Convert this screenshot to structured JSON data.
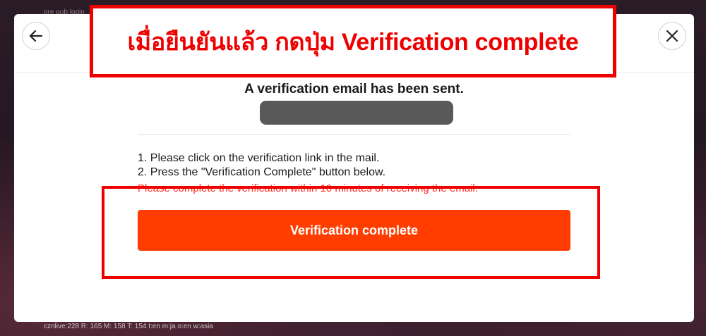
{
  "background": {
    "debug_top": "pre pub login",
    "debug_bottom": "cznlive:228 R: 165 M: 158 T: 154 t:en m:ja o:en w:asia"
  },
  "modal": {
    "title": "A verification email has been sent.",
    "instructions": [
      "1. Please click on the verification link in the mail.",
      "2. Press the \"Verification Complete\" button below."
    ],
    "warning": "Please complete the verification within 10 minutes of receiving the email.",
    "verify_button_label": "Verification complete",
    "back_icon": "arrow-left-icon",
    "close_icon": "close-icon"
  },
  "annotation": {
    "caption": "เมื่อยืนยันแล้ว กดปุ่ม Verification complete"
  },
  "colors": {
    "accent_button": "#ff3d00",
    "warning_text": "#ff2a1f",
    "annotation_red": "#ee0000",
    "redaction": "#595959"
  }
}
